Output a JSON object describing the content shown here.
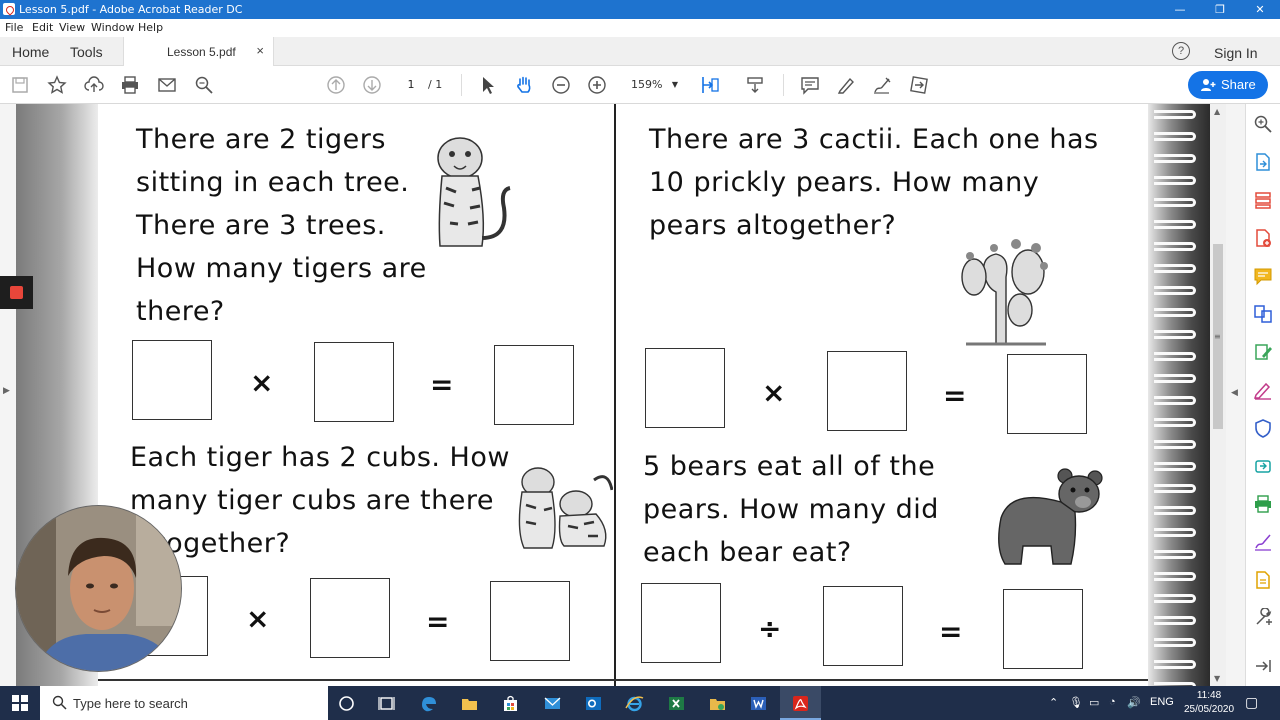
{
  "window": {
    "title": "Lesson 5.pdf - Adobe Acrobat Reader DC",
    "minimize": "—",
    "maximize": "❐",
    "close": "✕"
  },
  "menu": [
    "File",
    "Edit",
    "View",
    "Window",
    "Help"
  ],
  "tabs": {
    "home": "Home",
    "tools": "Tools",
    "document": "Lesson 5.pdf",
    "close": "×",
    "help": "?",
    "sign_in": "Sign In"
  },
  "toolbar": {
    "current_page": "1",
    "total_pages": "/ 1",
    "zoom": "159%",
    "share_label": "Share"
  },
  "worksheet": {
    "q1": "There are 2 tigers\nsitting in each tree.\nThere are 3 trees.\nHow many tigers are\nthere?",
    "q2": "Each tiger has 2 cubs. How\nmany tiger cubs are there\naltogether?",
    "q3": "There are 3 cactii. Each one has\n10 prickly pears. How many\npears altogether?",
    "q4": "5 bears eat all of the\npears. How many did\neach bear eat?",
    "ops": {
      "times": "×",
      "equals": "=",
      "divide": "÷"
    }
  },
  "taskbar": {
    "search_placeholder": "Type here to search",
    "lang": "ENG",
    "time": "11:48",
    "date": "25/05/2020"
  },
  "colors": {
    "title_bar": "#1e73cf",
    "share_button": "#1473e6",
    "taskbar": "#1f2e4a",
    "record": "#e8463a"
  }
}
